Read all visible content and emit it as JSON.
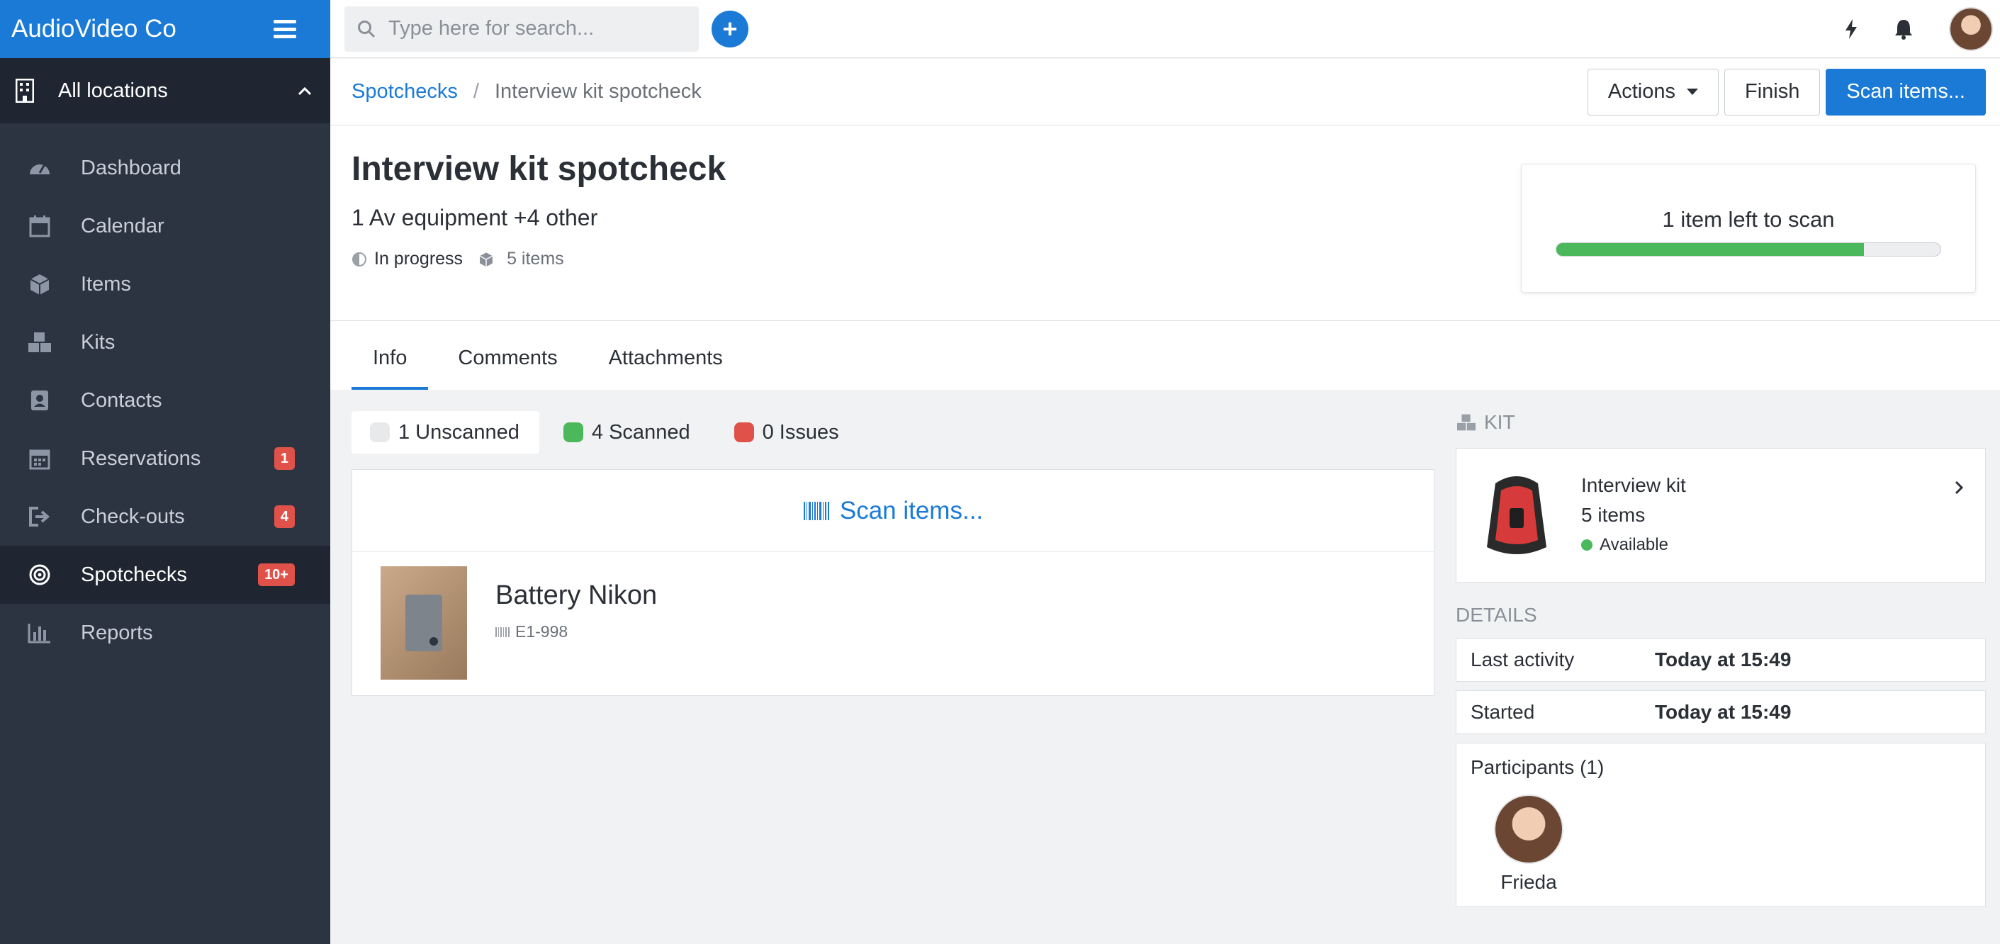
{
  "app": {
    "name": "AudioVideo Co"
  },
  "sidebar": {
    "location": "All locations",
    "items": [
      {
        "label": "Dashboard",
        "icon": "dashboard-icon"
      },
      {
        "label": "Calendar",
        "icon": "calendar-icon"
      },
      {
        "label": "Items",
        "icon": "box-icon"
      },
      {
        "label": "Kits",
        "icon": "boxes-icon"
      },
      {
        "label": "Contacts",
        "icon": "contact-book-icon"
      },
      {
        "label": "Reservations",
        "icon": "calendar-grid-icon",
        "badge": "1"
      },
      {
        "label": "Check-outs",
        "icon": "sign-out-icon",
        "badge": "4"
      },
      {
        "label": "Spotchecks",
        "icon": "target-icon",
        "badge": "10+",
        "active": true
      },
      {
        "label": "Reports",
        "icon": "bar-chart-icon"
      }
    ]
  },
  "topbar": {
    "search_placeholder": "Type here for search..."
  },
  "breadcrumb": {
    "parent": "Spotchecks",
    "separator": "/",
    "current": "Interview kit spotcheck"
  },
  "actions": {
    "actions_label": "Actions",
    "finish_label": "Finish",
    "scan_label": "Scan items..."
  },
  "spotcheck": {
    "title": "Interview kit spotcheck",
    "subtitle": "1 Av equipment +4 other",
    "status": "In progress",
    "items_count": "5 items",
    "progress_text": "1 item left to scan",
    "progress_fraction": 0.8
  },
  "tabs": [
    {
      "label": "Info",
      "active": true
    },
    {
      "label": "Comments"
    },
    {
      "label": "Attachments"
    }
  ],
  "filters": [
    {
      "label": "1 Unscanned",
      "color": "#e8e9eb",
      "active": true
    },
    {
      "label": "4 Scanned",
      "color": "#4cb85c"
    },
    {
      "label": "0 Issues",
      "color": "#e0514a"
    }
  ],
  "scan_panel": {
    "scan_label": "Scan items..."
  },
  "items": [
    {
      "name": "Battery Nikon",
      "code": "E1-998"
    }
  ],
  "kit": {
    "section_label": "KIT",
    "name": "Interview kit",
    "count": "5 items",
    "status": "Available"
  },
  "details": {
    "section_label": "DETAILS",
    "last_activity_label": "Last activity",
    "last_activity_value": "Today at 15:49",
    "started_label": "Started",
    "started_value": "Today at 15:49",
    "participants_label": "Participants (1)",
    "participants": [
      {
        "name": "Frieda"
      }
    ]
  },
  "colors": {
    "accent": "#1a7ad6",
    "sidebar": "#2c3441",
    "danger": "#e0514a",
    "success": "#4cb85c"
  }
}
